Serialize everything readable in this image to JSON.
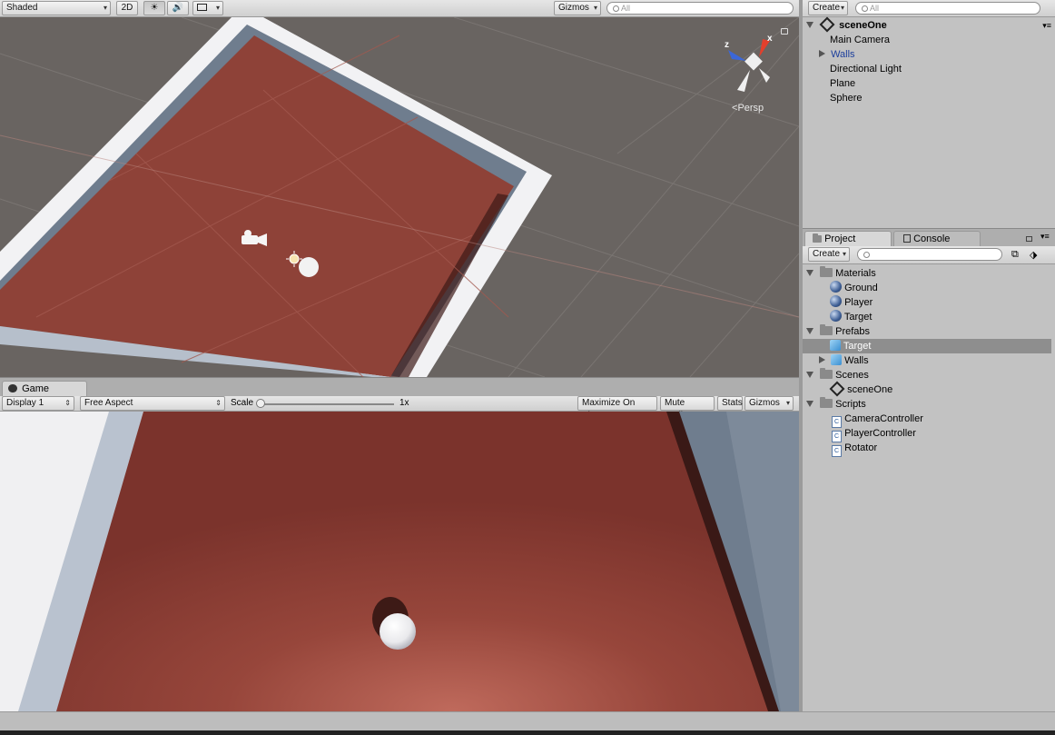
{
  "scene": {
    "shading_mode": "Shaded",
    "btn_2d": "2D",
    "gizmos_label": "Gizmos",
    "search_placeholder": "All",
    "persp_label": "Persp",
    "axis_x": "x",
    "axis_z": "z"
  },
  "game": {
    "tab_label": "Game",
    "display": "Display 1",
    "aspect": "Free Aspect",
    "scale_label": "Scale",
    "scale_value": "1x",
    "maximize": "Maximize On Play",
    "mute": "Mute Audio",
    "stats": "Stats",
    "gizmos": "Gizmos"
  },
  "hierarchy": {
    "create": "Create",
    "search_placeholder": "All",
    "scene_name": "sceneOne",
    "items": [
      "Main Camera",
      "Walls",
      "Directional Light",
      "Plane",
      "Sphere"
    ]
  },
  "project": {
    "tab_project": "Project",
    "tab_console": "Console",
    "create": "Create",
    "tree": [
      {
        "label": "Materials"
      },
      {
        "label": "Ground"
      },
      {
        "label": "Player"
      },
      {
        "label": "Target"
      },
      {
        "label": "Prefabs"
      },
      {
        "label": "Target"
      },
      {
        "label": "Walls"
      },
      {
        "label": "Scenes"
      },
      {
        "label": "sceneOne"
      },
      {
        "label": "Scripts"
      },
      {
        "label": "CameraController"
      },
      {
        "label": "PlayerController"
      },
      {
        "label": "Rotator"
      }
    ]
  },
  "colors": {
    "floor": "#8e4238",
    "wall_top": "#f2f2f4",
    "wall_side": "#6f7d8e",
    "grid_bg": "#696461",
    "selection": "#8e8e8e"
  }
}
